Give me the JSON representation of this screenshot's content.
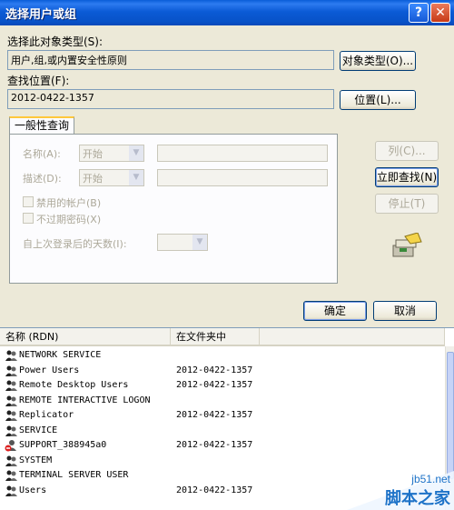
{
  "window": {
    "title": "选择用户或组"
  },
  "object_type": {
    "label": "选择此对象类型(S):",
    "value": "用户,组,或内置安全性原则",
    "button": "对象类型(O)..."
  },
  "location": {
    "label": "查找位置(F):",
    "value": "2012-0422-1357",
    "button": "位置(L)..."
  },
  "tab": {
    "label": "一般性查询"
  },
  "query": {
    "name_label": "名称(A):",
    "name_op": "开始",
    "desc_label": "描述(D):",
    "desc_op": "开始",
    "disabled_accounts": "禁用的帐户(B)",
    "no_expire_pwd": "不过期密码(X)",
    "days_label": "自上次登录后的天数(I):"
  },
  "side_buttons": {
    "columns": "列(C)...",
    "find_now": "立即查找(N)",
    "stop": "停止(T)"
  },
  "dialog_buttons": {
    "ok": "确定",
    "cancel": "取消"
  },
  "results": {
    "columns": [
      "名称 (RDN)",
      "在文件夹中"
    ],
    "rows": [
      {
        "name": "NETWORK SERVICE",
        "folder": "",
        "icon": "group-icon"
      },
      {
        "name": "Power Users",
        "folder": "2012-0422-1357",
        "icon": "group-icon"
      },
      {
        "name": "Remote Desktop Users",
        "folder": "2012-0422-1357",
        "icon": "group-icon"
      },
      {
        "name": "REMOTE INTERACTIVE LOGON",
        "folder": "",
        "icon": "group-icon"
      },
      {
        "name": "Replicator",
        "folder": "2012-0422-1357",
        "icon": "group-icon"
      },
      {
        "name": "SERVICE",
        "folder": "",
        "icon": "group-icon"
      },
      {
        "name": "SUPPORT_388945a0",
        "folder": "2012-0422-1357",
        "icon": "disabled-user-icon"
      },
      {
        "name": "SYSTEM",
        "folder": "",
        "icon": "group-icon"
      },
      {
        "name": "TERMINAL SERVER USER",
        "folder": "",
        "icon": "group-icon"
      },
      {
        "name": "Users",
        "folder": "2012-0422-1357",
        "icon": "group-icon"
      }
    ]
  },
  "watermark": {
    "line1": "jb51.net",
    "line2": "脚本之家"
  },
  "colors": {
    "titlebar": "#0a5ed8",
    "dialog_bg": "#ece9d8",
    "tab_accent": "#ffc83c",
    "watermark": "#1e73c8"
  }
}
